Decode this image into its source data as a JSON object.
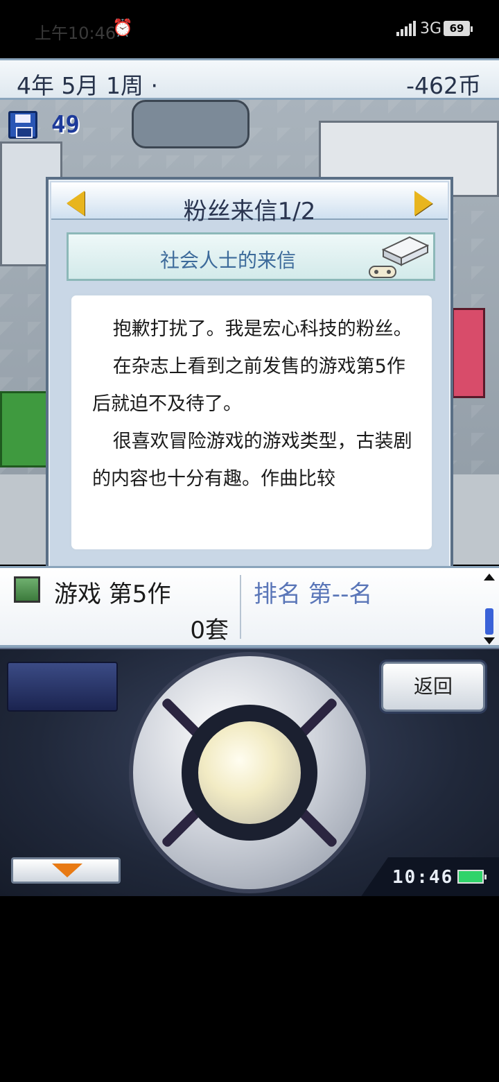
{
  "status_bar": {
    "time": "上午10:46",
    "network": "3G",
    "battery": "69"
  },
  "top_bar": {
    "date": "4年 5月 1周 ·",
    "money": "-462币"
  },
  "scene": {
    "save_count": "49"
  },
  "dialog": {
    "title": "粉丝来信1/2",
    "subject": "社会人士的来信",
    "letter_paragraphs": [
      "抱歉打扰了。我是宏心科技的粉丝。",
      "在杂志上看到之前发售的游戏第5作后就迫不及待了。",
      "很喜欢冒险游戏的游戏类型，古装剧的内容也十分有趣。作曲比较"
    ]
  },
  "info_strip": {
    "game_name": "游戏 第5作",
    "copies": "0套",
    "rank": "排名 第--名"
  },
  "controller": {
    "back_label": "返回",
    "clock": "10:46"
  },
  "colors": {
    "accent_arrow": "#e8b51e",
    "rank_text": "#5a76b8",
    "scroll_thumb": "#3a62d8"
  }
}
